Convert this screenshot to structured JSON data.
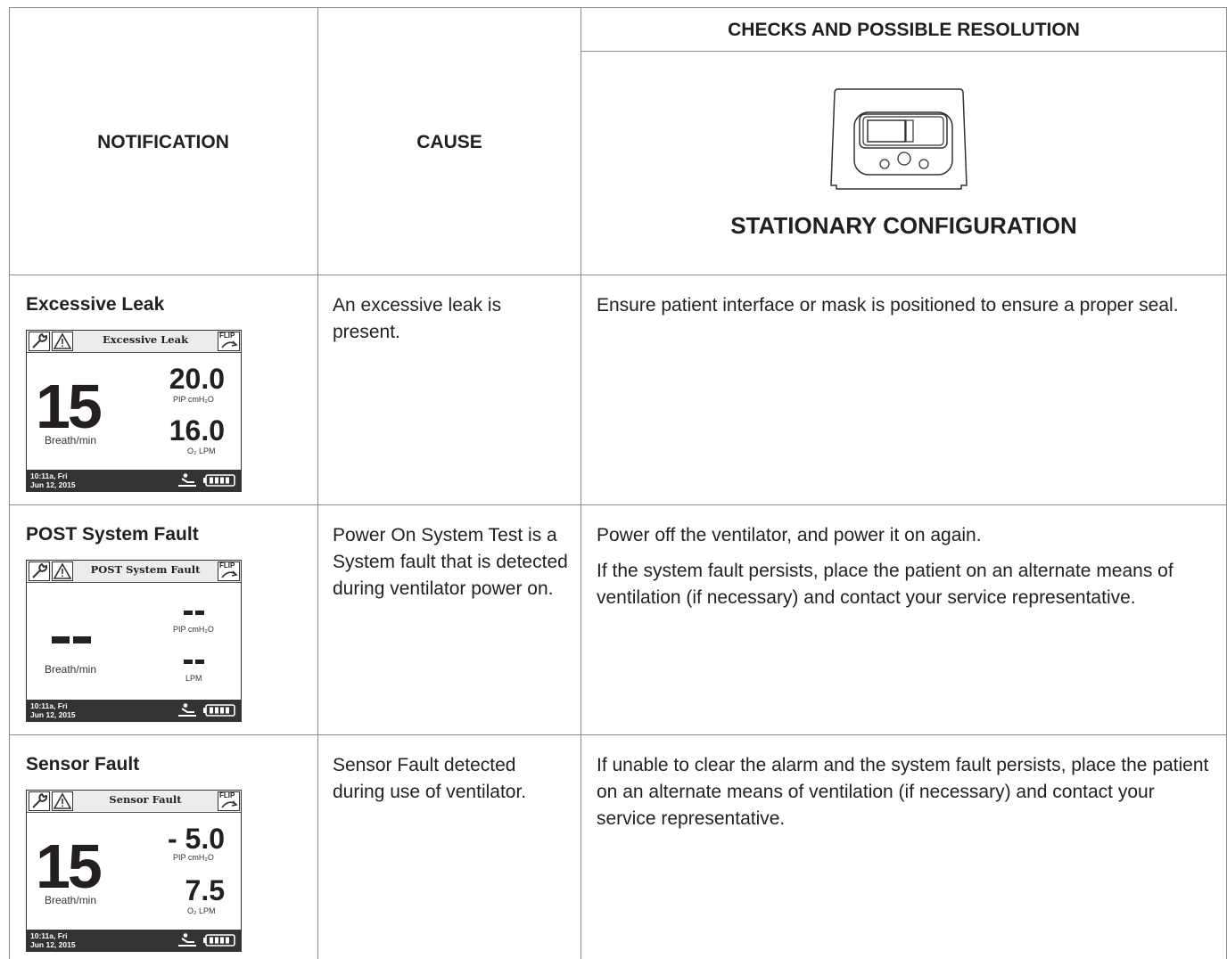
{
  "header": {
    "notification": "NOTIFICATION",
    "cause": "CAUSE",
    "checks": "CHECKS AND POSSIBLE RESOLUTION",
    "configuration": "STATIONARY CONFIGURATION"
  },
  "rows": [
    {
      "title": "Excessive Leak",
      "screen": {
        "title": "Excessive Leak",
        "flip": "FLIP",
        "big_value": "15",
        "breath_label": "Breath/min",
        "pip_value": "20.0",
        "pip_label": "PIP  cmH₂O",
        "o2_value": "16.0",
        "o2_label": "O₂  LPM",
        "date_line1": "10:11a, Fri",
        "date_line2": "Jun 12, 2015"
      },
      "cause": "An excessive leak is present.",
      "resolution": [
        "Ensure patient interface or mask is positioned to ensure a proper seal."
      ]
    },
    {
      "title": "POST System Fault",
      "screen": {
        "title": "POST System Fault",
        "flip": "FLIP",
        "breath_label": "Breath/min",
        "pip_label": "PIP  cmH₂O",
        "o2_label": "LPM",
        "date_line1": "10:11a, Fri",
        "date_line2": "Jun 12, 2015"
      },
      "cause": "Power On System Test is a System fault that is detected during ventilator power on.",
      "resolution": [
        "Power off the ventilator, and power it on again.",
        "If the system fault persists, place the patient on an alternate means of ventilation (if necessary) and contact your service representative."
      ]
    },
    {
      "title": "Sensor Fault",
      "screen": {
        "title": "Sensor Fault",
        "flip": "FLIP",
        "big_value": "15",
        "breath_label": "Breath/min",
        "pip_value": "- 5.0",
        "pip_label": "PIP  cmH₂O",
        "o2_value": "7.5",
        "o2_label": "O₂  LPM",
        "date_line1": "10:11a, Fri",
        "date_line2": "Jun 12, 2015"
      },
      "cause": "Sensor Fault detected during use of ventilator.",
      "resolution": [
        "If unable to clear the alarm and the system fault persists, place the patient on an alternate means of ventilation (if necessary) and contact your service representative."
      ]
    }
  ]
}
